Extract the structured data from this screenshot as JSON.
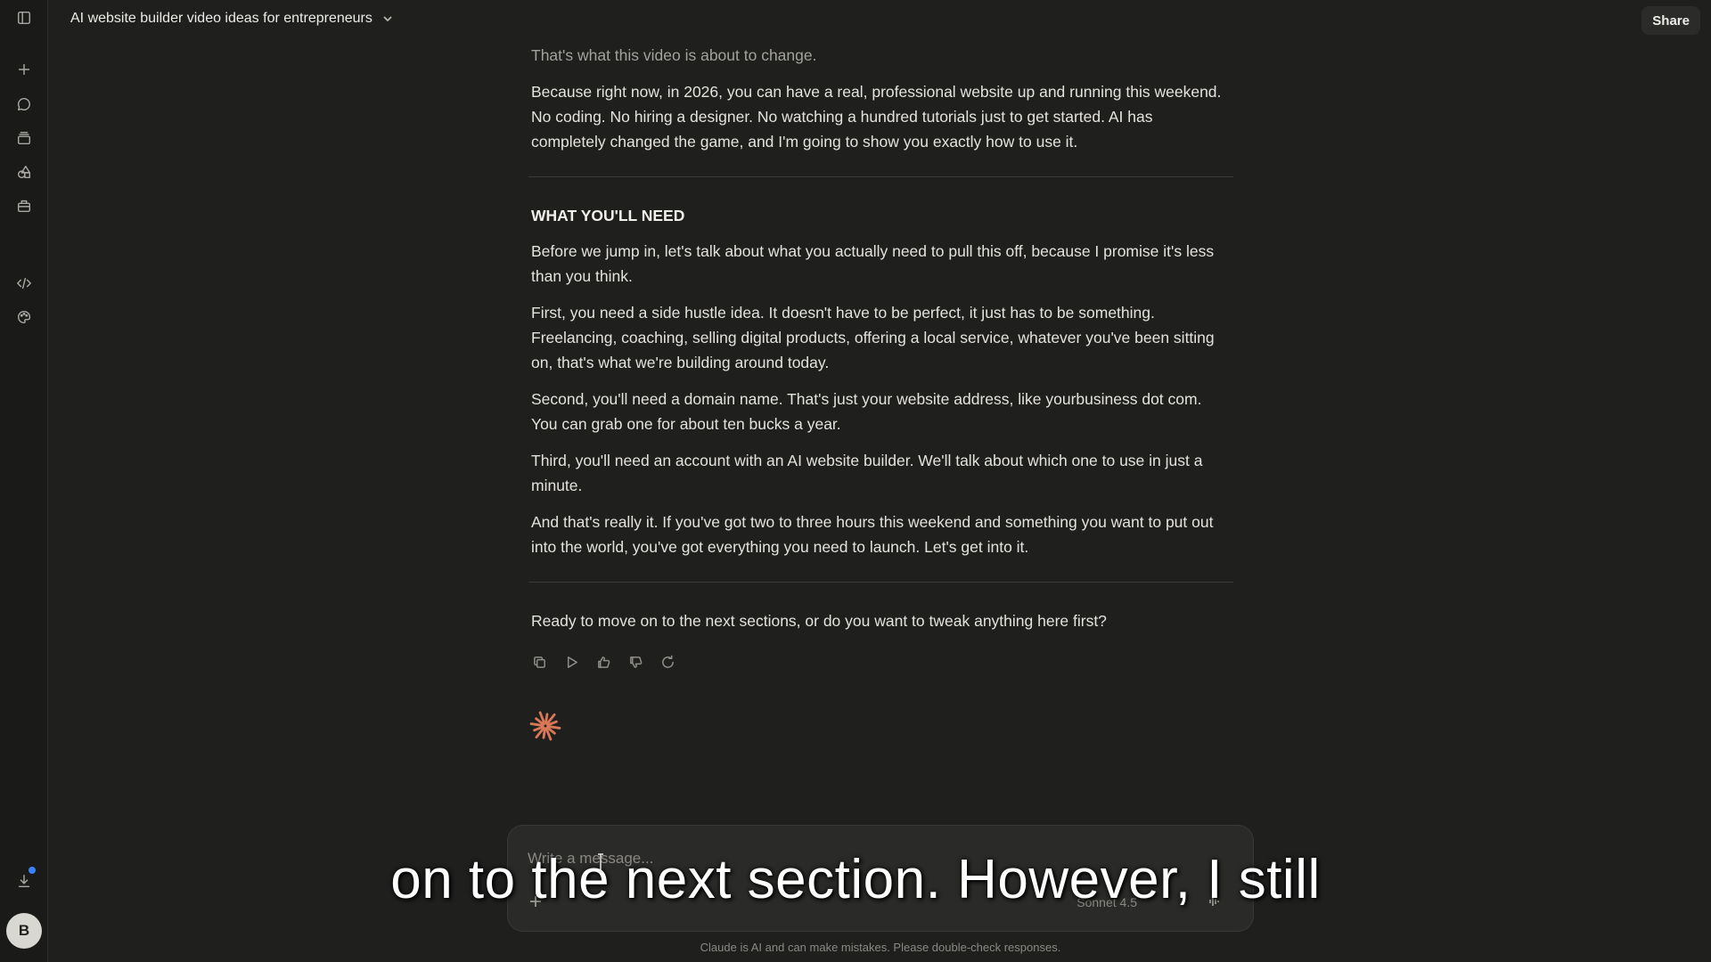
{
  "header": {
    "chat_title": "AI website builder video ideas for entrepreneurs",
    "share_label": "Share"
  },
  "sidebar": {
    "avatar_initial": "B",
    "icons": [
      "toggle-sidebar-icon",
      "new-chat-icon",
      "chats-icon",
      "projects-icon",
      "artifacts-icon",
      "tools-icon",
      "code-icon",
      "palette-icon",
      "download-icon"
    ]
  },
  "message": {
    "intro_tail": "That's what this video is about to change.",
    "intro_para": "Because right now, in 2026, you can have a real, professional website up and running this weekend. No coding. No hiring a designer. No watching a hundred tutorials just to get started. AI has completely changed the game, and I'm going to show you exactly how to use it.",
    "section_heading": "WHAT YOU'LL NEED",
    "paragraphs": [
      "Before we jump in, let's talk about what you actually need to pull this off, because I promise it's less than you think.",
      "First, you need a side hustle idea. It doesn't have to be perfect, it just has to be something. Freelancing, coaching, selling digital products, offering a local service, whatever you've been sitting on, that's what we're building around today.",
      "Second, you'll need a domain name. That's just your website address, like yourbusiness dot com. You can grab one for about ten bucks a year.",
      "Third, you'll need an account with an AI website builder. We'll talk about which one to use in just a minute.",
      "And that's really it. If you've got two to three hours this weekend and something you want to put out into the world, you've got everything you need to launch. Let's get into it."
    ],
    "closing_question": "Ready to move on to the next sections, or do you want to tweak anything here first?"
  },
  "composer": {
    "placeholder": "Write a message...",
    "model_label": "Sonnet 4.5"
  },
  "footer": {
    "disclaimer": "Claude is AI and can make mistakes. Please double-check responses."
  },
  "overlay": {
    "caption": "on to the next section. However, I still"
  },
  "colors": {
    "background": "#1f1f1e",
    "accent_spark": "#d97757",
    "notify_dot": "#3b82f6"
  }
}
